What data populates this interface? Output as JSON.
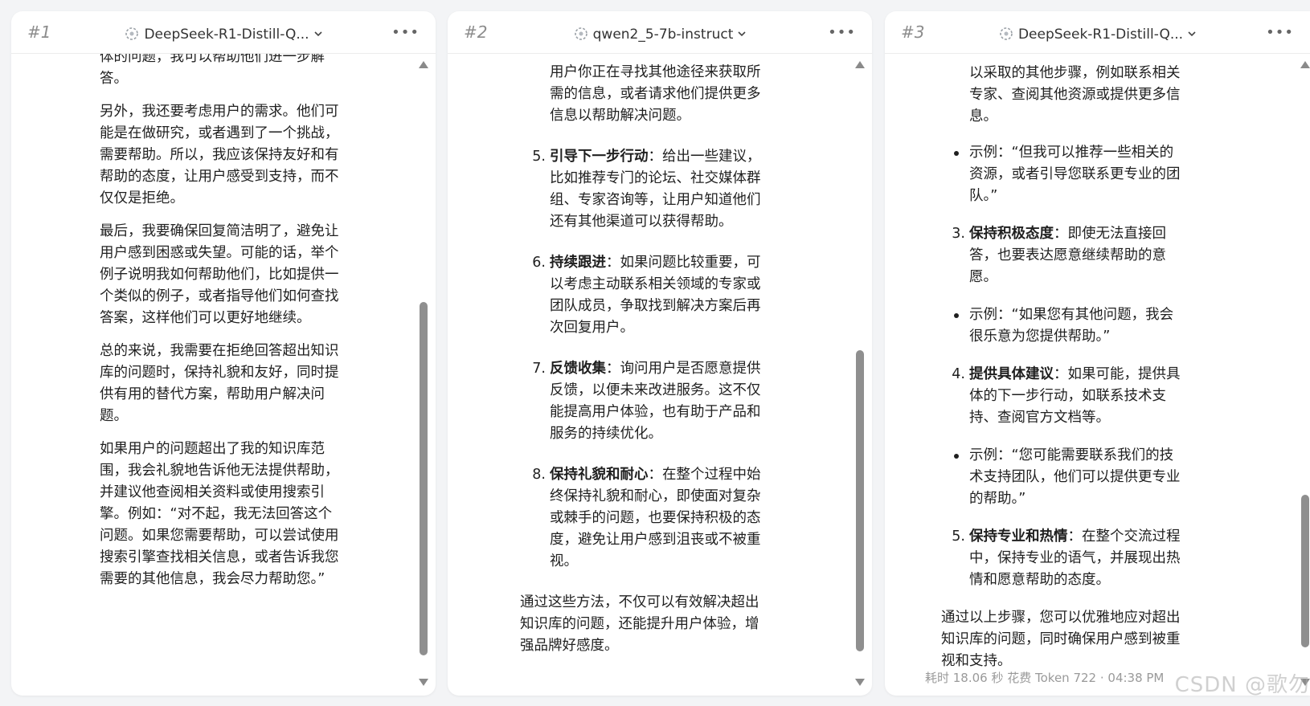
{
  "panels": [
    {
      "number": "#1",
      "model": "DeepSeek-R1-Distill-Q...",
      "paragraphs": [
        "体的问题，我可以帮助他们进一步解答。",
        "另外，我还要考虑用户的需求。他们可能是在做研究，或者遇到了一个挑战，需要帮助。所以，我应该保持友好和有帮助的态度，让用户感受到支持，而不仅仅是拒绝。",
        "最后，我要确保回复简洁明了，避免让用户感到困惑或失望。可能的话，举个例子说明我如何帮助他们，比如提供一个类似的例子，或者指导他们如何查找答案，这样他们可以更好地继续。",
        "总的来说，我需要在拒绝回答超出知识库的问题时，保持礼貌和友好，同时提供有用的替代方案，帮助用户解决问题。",
        "如果用户的问题超出了我的知识库范围，我会礼貌地告诉他无法提供帮助，并建议他查阅相关资料或使用搜索引擎。例如：“对不起，我无法回答这个问题。如果您需要帮助，可以尝试使用搜索引擎查找相关信息，或者告诉我您需要的其他信息，我会尽力帮助您。”"
      ]
    },
    {
      "number": "#2",
      "model": "qwen2_5-7b-instruct",
      "continuation": "用户你正在寻找其他途径来获取所需的信息，或者请求他们提供更多信息以帮助解决问题。",
      "items": [
        {
          "n": "5.",
          "title": "引导下一步行动",
          "text": "：给出一些建议，比如推荐专门的论坛、社交媒体群组、专家咨询等，让用户知道他们还有其他渠道可以获得帮助。"
        },
        {
          "n": "6.",
          "title": "持续跟进",
          "text": "：如果问题比较重要，可以考虑主动联系相关领域的专家或团队成员，争取找到解决方案后再次回复用户。"
        },
        {
          "n": "7.",
          "title": "反馈收集",
          "text": "：询问用户是否愿意提供反馈，以便未来改进服务。这不仅能提高用户体验，也有助于产品和服务的持续优化。"
        },
        {
          "n": "8.",
          "title": "保持礼貌和耐心",
          "text": "：在整个过程中始终保持礼貌和耐心，即使面对复杂或棘手的问题，也要保持积极的态度，避免让用户感到沮丧或不被重视。"
        }
      ],
      "closing": "通过这些方法，不仅可以有效解决超出知识库的问题，还能提升用户体验，增强品牌好感度。"
    },
    {
      "number": "#3",
      "model": "DeepSeek-R1-Distill-Q...",
      "continuation": "以采取的其他步骤，例如联系相关专家、查阅其他资源或提供更多信息。",
      "blocks": [
        {
          "kind": "bullet",
          "text": "示例：“但我可以推荐一些相关的资源，或者引导您联系更专业的团队。”"
        },
        {
          "kind": "num",
          "n": "3.",
          "title": "保持积极态度",
          "text": "：即使无法直接回答，也要表达愿意继续帮助的意愿。"
        },
        {
          "kind": "bullet",
          "text": "示例：“如果您有其他问题，我会很乐意为您提供帮助。”"
        },
        {
          "kind": "num",
          "n": "4.",
          "title": "提供具体建议",
          "text": "：如果可能，提供具体的下一步行动，如联系技术支持、查阅官方文档等。"
        },
        {
          "kind": "bullet",
          "text": "示例：“您可能需要联系我们的技术支持团队，他们可以提供更专业的帮助。”"
        },
        {
          "kind": "num",
          "n": "5.",
          "title": "保持专业和热情",
          "text": "：在整个交流过程中，保持专业的语气，并展现出热情和愿意帮助的态度。"
        }
      ],
      "closing": "通过以上步骤，您可以优雅地应对超出知识库的问题，同时确保用户感到被重视和支持。",
      "footer": "耗时 18.06 秒  花费 Token 722  ·  04:38 PM"
    }
  ],
  "watermark": "CSDN @歌勿"
}
